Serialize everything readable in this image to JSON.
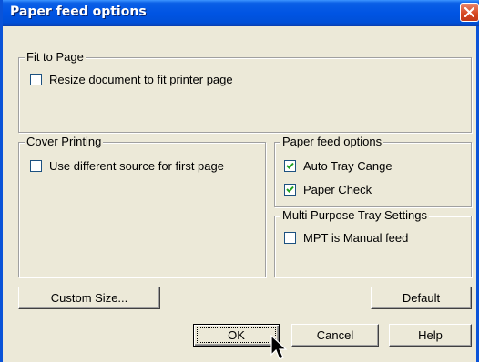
{
  "window": {
    "title": "Paper feed options",
    "title_bar_color": "#0054E3",
    "close_icon": "close-icon"
  },
  "fit_to_page": {
    "label": "Fit to Page",
    "resize_checkbox": {
      "label": "Resize document to fit printer page",
      "checked": false
    }
  },
  "cover_printing": {
    "label": "Cover Printing",
    "different_source_checkbox": {
      "label": "Use different source for first page",
      "checked": false
    }
  },
  "paper_feed": {
    "label": "Paper feed options",
    "auto_tray_checkbox": {
      "label": "Auto Tray Cange",
      "checked": true
    },
    "paper_check_checkbox": {
      "label": "Paper Check",
      "checked": true
    }
  },
  "mpt": {
    "label": "Multi Purpose Tray Settings",
    "manual_feed_checkbox": {
      "label": "MPT is Manual feed",
      "checked": false
    }
  },
  "buttons": {
    "custom_size": "Custom Size...",
    "default": "Default",
    "ok": "OK",
    "cancel": "Cancel",
    "help": "Help"
  }
}
